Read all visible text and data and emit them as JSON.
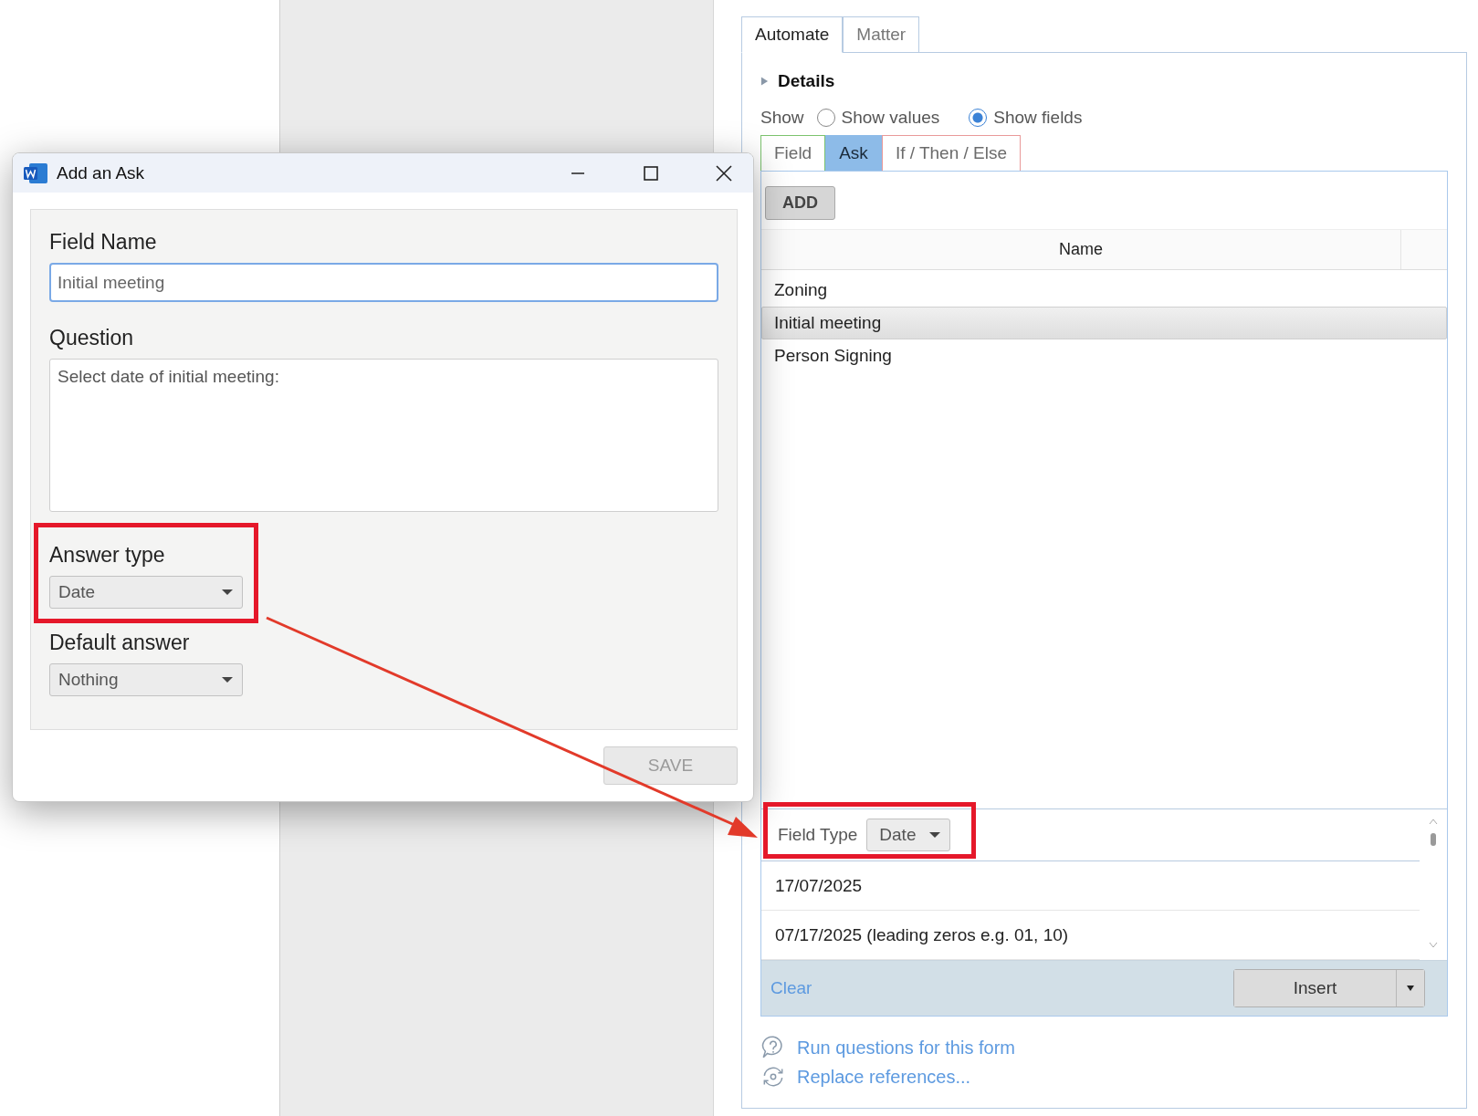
{
  "dialog": {
    "title": "Add an Ask",
    "field_name": {
      "label": "Field Name",
      "value": "Initial meeting"
    },
    "question": {
      "label": "Question",
      "value": "Select date of initial meeting:"
    },
    "answer_type": {
      "label": "Answer type",
      "value": "Date"
    },
    "default_answer": {
      "label": "Default answer",
      "value": "Nothing"
    },
    "save_button": {
      "label": "SAVE",
      "disabled": true
    }
  },
  "panel": {
    "tabs": [
      {
        "label": "Automate",
        "selected": true
      },
      {
        "label": "Matter",
        "selected": false
      }
    ],
    "details": {
      "label": "Details",
      "expanded": false
    },
    "show": {
      "label": "Show",
      "options": [
        {
          "label": "Show values",
          "selected": false
        },
        {
          "label": "Show fields",
          "selected": true
        }
      ]
    },
    "sub_tabs": [
      {
        "label": "Field",
        "selected": false,
        "color": "#7cc36e"
      },
      {
        "label": "Ask",
        "selected": true,
        "color": "#8dbbe8"
      },
      {
        "label": "If / Then / Else",
        "selected": false,
        "color": "#e99a9a"
      }
    ],
    "add_button": "ADD",
    "table": {
      "columns": [
        "Name"
      ],
      "rows": [
        {
          "name": "Zoning",
          "selected": false
        },
        {
          "name": "Initial meeting",
          "selected": true
        },
        {
          "name": "Person Signing",
          "selected": false
        }
      ]
    },
    "field_type": {
      "label": "Field Type",
      "value": "Date"
    },
    "formats": [
      {
        "text": "17/07/2025"
      },
      {
        "text": "07/17/2025 (leading zeros e.g. 01, 10)"
      }
    ],
    "clear_link": "Clear",
    "insert_button": "Insert",
    "links": [
      {
        "kind": "help",
        "label": "Run questions for this form"
      },
      {
        "kind": "replace",
        "label": "Replace references..."
      }
    ]
  }
}
